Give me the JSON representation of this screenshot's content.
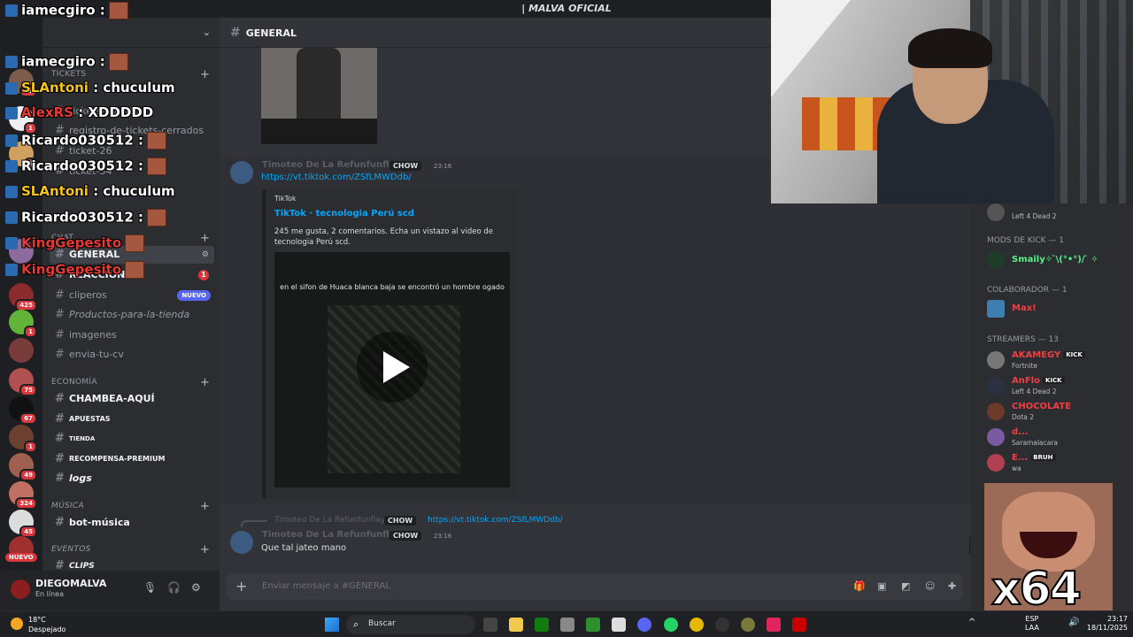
{
  "titlebar": {
    "title": "| MALVA OFICIAL"
  },
  "server_rail": {
    "counts": [
      "71",
      "1",
      "425",
      "1",
      "75",
      "67",
      "1",
      "49",
      "324",
      "45"
    ],
    "nuevo": "NUEVO"
  },
  "sidebar": {
    "categories": {
      "tickets": "TICKETS",
      "chat": "CHAT",
      "economia": "ECONOMÍA",
      "musica": "MÚSICA",
      "eventos": "EVENTOS"
    },
    "channels": [
      {
        "name": "tickets-abiertos"
      },
      {
        "name": "registro-de-tickets-cerrados"
      },
      {
        "name": "ticket-26"
      },
      {
        "name": "ticket-34"
      },
      {
        "name": "GENERAL",
        "active": true
      },
      {
        "name": "REACCIONES",
        "count": "1"
      },
      {
        "name": "cliperos",
        "badge": "NUEVO"
      },
      {
        "name": "Productos-para-la-tienda"
      },
      {
        "name": "imagenes"
      },
      {
        "name": "envia-tu-cv"
      },
      {
        "name": "CHAMBEA-AQUÍ"
      },
      {
        "name": "APUESTAS"
      },
      {
        "name": "TIENDA"
      },
      {
        "name": "RECOMPENSA-PREMIUM"
      },
      {
        "name": "logs"
      },
      {
        "name": "bot-música"
      },
      {
        "name": "CLIPS"
      }
    ]
  },
  "user_panel": {
    "name": "DIEGOMALVA",
    "status": "En línea"
  },
  "main": {
    "channel_title": "GENERAL",
    "messages": [
      {
        "author": "Timoteo De La Refunfunflaya",
        "tag": "CHOW",
        "time": "23:16",
        "link": "https://vt.tiktok.com/ZSfLMWDdb/",
        "embed": {
          "provider": "TikTok",
          "title": "TikTok · tecnologia Perú scd",
          "description": "245 me gusta, 2 comentarios. Echa un vistazo al video de tecnologia Perú scd.",
          "video_caption": "en el sifon de Huaca blanca baja se encontró un hombre ogado"
        }
      },
      {
        "reply_author": "Timoteo De La Refunfunflaya",
        "reply_tag": "CHOW",
        "reply_link": "https://vt.tiktok.com/ZSfLMWDdb/",
        "author": "Timoteo De La Refunfunflaya",
        "tag": "CHOW",
        "time": "23:16",
        "text": "Que tal jateo mano"
      }
    ],
    "composer_placeholder": "Enviar mensaje a #GENERAL"
  },
  "members": {
    "top_activity": "Left 4 Dead 2",
    "sections": {
      "mods": "MODS DE KICK — 1",
      "colab": "COLABORADOR — 1",
      "streamers": "STREAMERS — 13"
    },
    "list": [
      {
        "name": "Smaily✧ ̄\\(°•°)/ ̄ ✧",
        "color": "#57f287"
      },
      {
        "name": "Max!",
        "color": "#f23f42"
      },
      {
        "name": "AKAMEGY",
        "activity": "Fortnite",
        "kick": "KICK",
        "color": "#f23f42"
      },
      {
        "name": "AnFlo",
        "activity": "Left 4 Dead 2",
        "kick": "KICK",
        "color": "#f23f42"
      },
      {
        "name": "CHOCOLATE",
        "activity": "Dota 2",
        "color": "#f23f42"
      },
      {
        "name": "d...",
        "activity": "Saramalacara",
        "color": "#f23f42"
      },
      {
        "name": "E...",
        "activity": "wa",
        "kick": "BRUH",
        "color": "#f23f42"
      }
    ]
  },
  "overlay_chat": [
    {
      "user": "iamecgiro",
      "msg": "",
      "color": "#ffffff"
    },
    {
      "user": "iamecgiro",
      "msg": "",
      "color": "#ffffff"
    },
    {
      "user": "SLAntoni",
      "msg": "chuculum",
      "color": "#f5c518"
    },
    {
      "user": "AlexRS",
      "msg": "XDDDDD",
      "color": "#e53935"
    },
    {
      "user": "Ricardo030512",
      "msg": "",
      "color": "#ffffff"
    },
    {
      "user": "Ricardo030512",
      "msg": "",
      "color": "#ffffff"
    },
    {
      "user": "SLAntoni",
      "msg": "chuculum",
      "color": "#f5c518"
    },
    {
      "user": "Ricardo030512",
      "msg": "",
      "color": "#ffffff"
    },
    {
      "user": "KingGepesito",
      "msg": "",
      "color": "#e53935"
    },
    {
      "user": "KingGepesito",
      "msg": "",
      "color": "#e53935"
    }
  ],
  "emote_overlay": {
    "text": "x64"
  },
  "taskbar": {
    "weather_temp": "18°C",
    "weather_cond": "Despejado",
    "search": "Buscar",
    "lang": "ESP",
    "region": "LAA",
    "time": "23:17",
    "date": "18/11/2025"
  }
}
